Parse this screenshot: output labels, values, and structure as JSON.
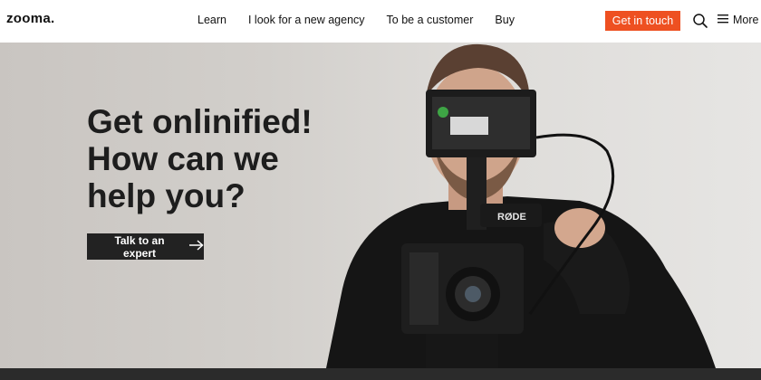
{
  "header": {
    "logo": "zooma.",
    "nav": [
      "Learn",
      "I look for a new agency",
      "To be a customer",
      "Buy"
    ],
    "cta_label": "Get in touch",
    "more_label": "More"
  },
  "hero": {
    "headline": [
      "Get onlinified!",
      "How can we",
      "help you?"
    ],
    "button_label": "Talk to an expert",
    "camera_brand": "RØDE"
  },
  "colors": {
    "accent": "#ee5021",
    "dark_button": "#222222"
  },
  "icons": [
    "search-icon",
    "menu-icon",
    "arrow-right-icon"
  ]
}
